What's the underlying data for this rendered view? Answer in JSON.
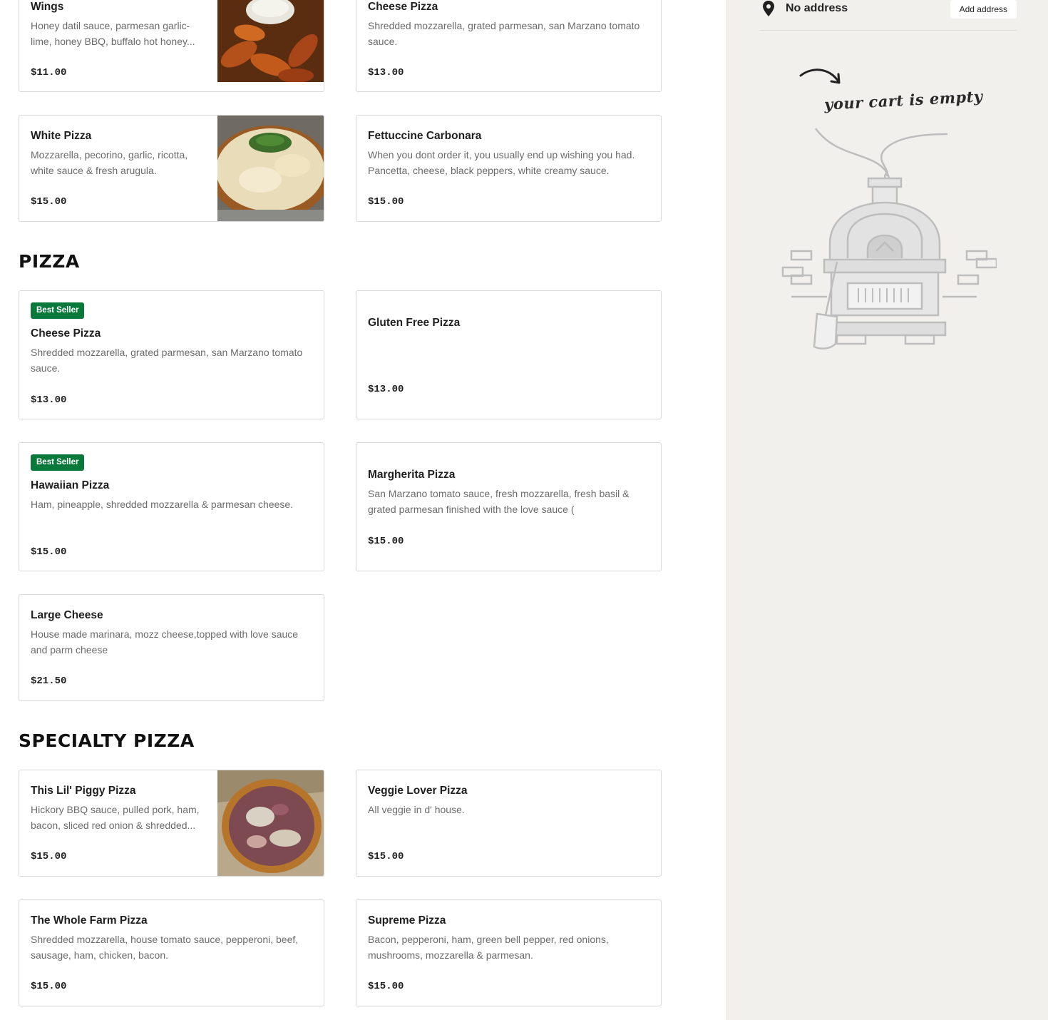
{
  "sidebar": {
    "address_text": "No address",
    "add_address_label": "Add address",
    "empty_cart_text": "your cart is empty"
  },
  "sections": {
    "pizza_title": "PIZZA",
    "specialty_title": "SPECIALTY PIZZA"
  },
  "items": {
    "wings": {
      "name": "Wings",
      "desc": "Honey datil sauce, parmesan garlic-lime, honey BBQ, buffalo hot honey...",
      "price": "$11.00"
    },
    "cheese_top": {
      "name": "Cheese Pizza",
      "desc": "Shredded mozzarella, grated parmesan, san Marzano tomato sauce.",
      "price": "$13.00"
    },
    "white": {
      "name": "White Pizza",
      "desc": "Mozzarella, pecorino, garlic, ricotta, white sauce & fresh arugula.",
      "price": "$15.00"
    },
    "carbonara": {
      "name": "Fettuccine Carbonara",
      "desc": "When you dont order it, you usually end up wishing you had. Pancetta, cheese, black peppers, white creamy sauce.",
      "price": "$15.00"
    },
    "cheese": {
      "badge": "Best Seller",
      "name": "Cheese Pizza",
      "desc": "Shredded mozzarella, grated parmesan, san Marzano tomato sauce.",
      "price": "$13.00"
    },
    "gluten_free": {
      "name": "Gluten Free Pizza",
      "price": "$13.00"
    },
    "hawaiian": {
      "badge": "Best Seller",
      "name": "Hawaiian Pizza",
      "desc": "Ham, pineapple, shredded mozzarella & parmesan cheese.",
      "price": "$15.00"
    },
    "margherita": {
      "name": "Margherita Pizza",
      "desc": "San Marzano tomato sauce, fresh mozzarella, fresh basil & grated parmesan finished with the love sauce (",
      "price": "$15.00"
    },
    "large_cheese": {
      "name": "Large Cheese",
      "desc": "House made marinara, mozz cheese,topped with love sauce and parm cheese",
      "price": "$21.50"
    },
    "piggy": {
      "name": "This Lil' Piggy Pizza",
      "desc": "Hickory BBQ sauce, pulled pork, ham, bacon, sliced red onion & shredded...",
      "price": "$15.00"
    },
    "veggie": {
      "name": "Veggie Lover Pizza",
      "desc": "All veggie in d' house.",
      "price": "$15.00"
    },
    "whole_farm": {
      "name": "The Whole Farm Pizza",
      "desc": "Shredded mozzarella, house tomato sauce, pepperoni, beef, sausage, ham, chicken, bacon.",
      "price": "$15.00"
    },
    "supreme": {
      "name": "Supreme Pizza",
      "desc": "Bacon, pepperoni, ham, green bell pepper, red onions, mushrooms, mozzarella & parmesan.",
      "price": "$15.00"
    }
  }
}
